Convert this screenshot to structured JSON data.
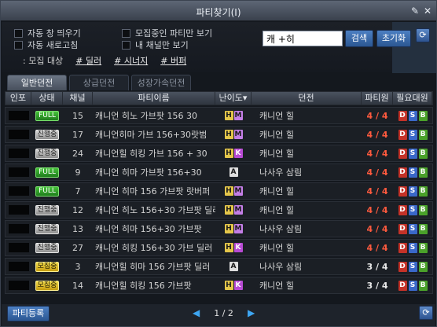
{
  "window": {
    "title": "파티찾기(I)",
    "pin_icon": "pin-icon",
    "close_icon": "close-icon"
  },
  "options": {
    "auto_popup": "자동 창 띄우기",
    "auto_refresh": "자동 새로고침",
    "recruiting_only": "모집중인 파티만 보기",
    "my_channel_only": "내 채널만 보기"
  },
  "search": {
    "value": "캐 +히",
    "button": "검색",
    "reset": "초기화"
  },
  "recruit_targets": {
    "label": ": 모집 대상",
    "tags": [
      "# 딜러",
      "# 시너지",
      "# 버퍼"
    ]
  },
  "tabs": [
    "일반던전",
    "상급던전",
    "성장가속던전"
  ],
  "columns": [
    "인포",
    "상태",
    "채널",
    "파티이름",
    "난이도▾",
    "던전",
    "파티원",
    "필요대원"
  ],
  "rows": [
    {
      "status": "FULL",
      "channel": "15",
      "name": "캐니언 히노 가브팟 156 30",
      "diff": [
        "H",
        "M"
      ],
      "dungeon": "캐니언 힐",
      "members": "4 / 4"
    },
    {
      "status": "진행중",
      "channel": "17",
      "name": "캐니언히마 가브 156+30랏범",
      "diff": [
        "H",
        "M"
      ],
      "dungeon": "캐니언 힐",
      "members": "4 / 4"
    },
    {
      "status": "진행중",
      "channel": "24",
      "name": "캐니언힐 히킹 가브 156 + 30",
      "diff": [
        "H",
        "K"
      ],
      "dungeon": "캐니언 힐",
      "members": "4 / 4"
    },
    {
      "status": "FULL",
      "channel": "9",
      "name": "캐니언 히마 가브팟 156+30",
      "diff": [
        "A"
      ],
      "dungeon": "나사우 삼림",
      "members": "4 / 4"
    },
    {
      "status": "FULL",
      "channel": "7",
      "name": "캐니언 히마 156 가브팟 랏버퍼",
      "diff": [
        "H",
        "M"
      ],
      "dungeon": "캐니언 힐",
      "members": "4 / 4"
    },
    {
      "status": "진행중",
      "channel": "12",
      "name": "캐니언 히노 156+30 가브팟 딜러",
      "diff": [
        "H",
        "M"
      ],
      "dungeon": "캐니언 힐",
      "members": "4 / 4"
    },
    {
      "status": "진행중",
      "channel": "13",
      "name": "캐니언 히마 156+30 가브팟",
      "diff": [
        "H",
        "M"
      ],
      "dungeon": "나사우 삼림",
      "members": "4 / 4"
    },
    {
      "status": "진행중",
      "channel": "27",
      "name": "캐니언 히킹 156+30 가브 딜러",
      "diff": [
        "H",
        "K"
      ],
      "dungeon": "캐니언 힐",
      "members": "4 / 4"
    },
    {
      "status": "모집중",
      "channel": "3",
      "name": "캐니언힐 히마 156 가브팟 딜러",
      "diff": [
        "A"
      ],
      "dungeon": "나사우 삼림",
      "members": "3 / 4"
    },
    {
      "status": "모집중",
      "channel": "14",
      "name": "캐니언힐 히킹 156 가브팟",
      "diff": [
        "H",
        "K"
      ],
      "dungeon": "캐니언 힐",
      "members": "3 / 4"
    }
  ],
  "bottom": {
    "register": "파티등록",
    "page": "1 / 2"
  },
  "colors": {
    "full": "#2fa52a",
    "in_progress": "#b5b5b5",
    "recruiting": "#e2c02a",
    "count_full": "#ff5a3e",
    "accent": "#3d6fb3"
  }
}
